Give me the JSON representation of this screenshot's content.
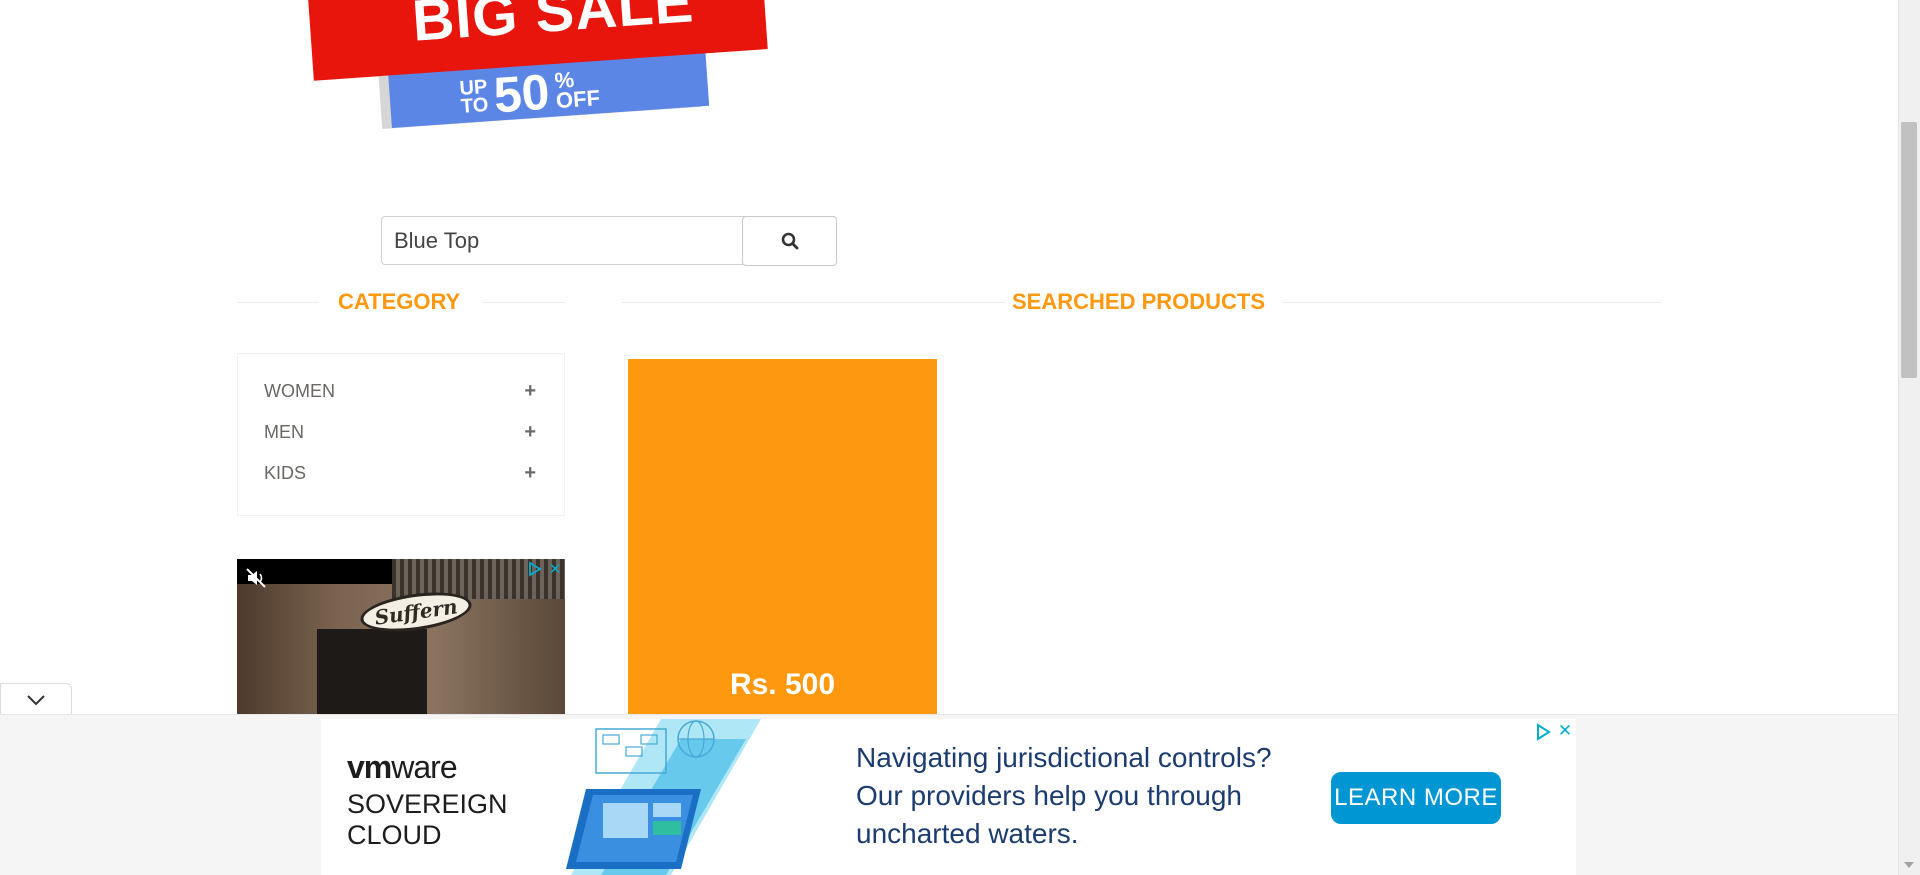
{
  "banner": {
    "headline": "BIG SALE",
    "up": "UP",
    "to": "TO",
    "percent": "50",
    "percent_sign": "%",
    "off": "OFF"
  },
  "search": {
    "value": "Blue Top",
    "button_icon": "search-icon"
  },
  "sidebar": {
    "title": "CATEGORY",
    "categories": [
      {
        "label": "WOMEN",
        "icon": "plus-icon"
      },
      {
        "label": "MEN",
        "icon": "plus-icon"
      },
      {
        "label": "KIDS",
        "icon": "plus-icon"
      }
    ]
  },
  "video_ad": {
    "sign_text": "Suffern"
  },
  "main": {
    "title": "SEARCHED PRODUCTS",
    "products": [
      {
        "price": "Rs. 500"
      }
    ]
  },
  "bottom_ad": {
    "brand_vm": "vm",
    "brand_ware": "ware",
    "product_line1": "SOVEREIGN",
    "product_line2": "CLOUD",
    "headline_line1": "Navigating jurisdictional controls?",
    "headline_line2": "Our providers help you through",
    "headline_line3": "uncharted waters.",
    "cta": "LEARN MORE"
  },
  "colors": {
    "accent": "#fe980f",
    "cta_blue": "#0095d3",
    "headline_blue": "#1c3c6f",
    "sale_red": "#e8150d"
  }
}
